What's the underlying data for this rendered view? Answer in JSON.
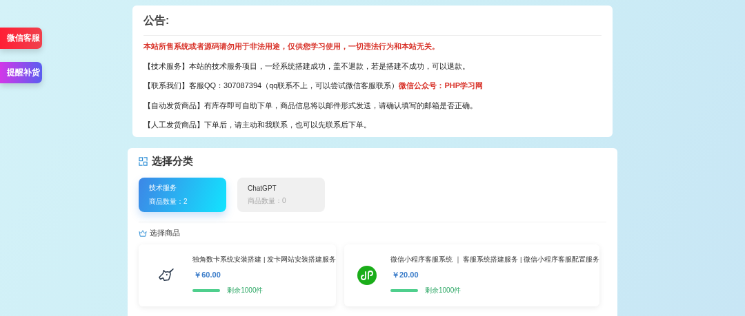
{
  "side_buttons": [
    {
      "label": "微信客服",
      "kind": "wechat"
    },
    {
      "label": "提醒补货",
      "kind": "restock"
    }
  ],
  "notice": {
    "title": "公告:",
    "lines": [
      {
        "segments": [
          {
            "text": "本站所售系统或者源码请勿用于非法用途，仅供您学习使用，一切违法行为和本站无关。",
            "highlight": true
          }
        ]
      },
      {
        "segments": [
          {
            "text": "【技术服务】本站的技术服务项目，一经系统搭建成功，盖不退款，若是搭建不成功，可以退款。",
            "highlight": false
          }
        ]
      },
      {
        "segments": [
          {
            "text": "【联系我们】客服QQ：307087394（qq联系不上，可以尝试微信客服联系）",
            "highlight": false
          },
          {
            "text": "微信公众号：PHP学习网",
            "highlight": true
          }
        ]
      },
      {
        "segments": [
          {
            "text": "【自动发货商品】有库存即可自助下单，商品信息将以邮件形式发送，请确认填写的邮箱是否正确。",
            "highlight": false
          }
        ]
      },
      {
        "segments": [
          {
            "text": "【人工发货商品】下单后，请主动和我联系，也可以先联系后下单。",
            "highlight": false
          }
        ]
      }
    ]
  },
  "category_section": {
    "title": "选择分类",
    "categories": [
      {
        "name": "技术服务",
        "count": "商品数量：2",
        "selected": true
      },
      {
        "name": "ChatGPT",
        "count": "商品数量：0",
        "selected": false
      }
    ]
  },
  "product_section": {
    "title": "选择商品",
    "products": [
      {
        "name": "独角数卡系统安装搭建 | 发卡网站安装搭建服务",
        "price": "￥60.00",
        "stock": "剩余1000件",
        "level": 1,
        "kind": "unicorn"
      },
      {
        "name": "微信小程序客服系统 ｜ 客服系统搭建服务 | 微信小程序客服配置服务",
        "price": "￥20.00",
        "stock": "剩余1000件",
        "level": 1,
        "kind": "miniprogram"
      }
    ]
  }
}
